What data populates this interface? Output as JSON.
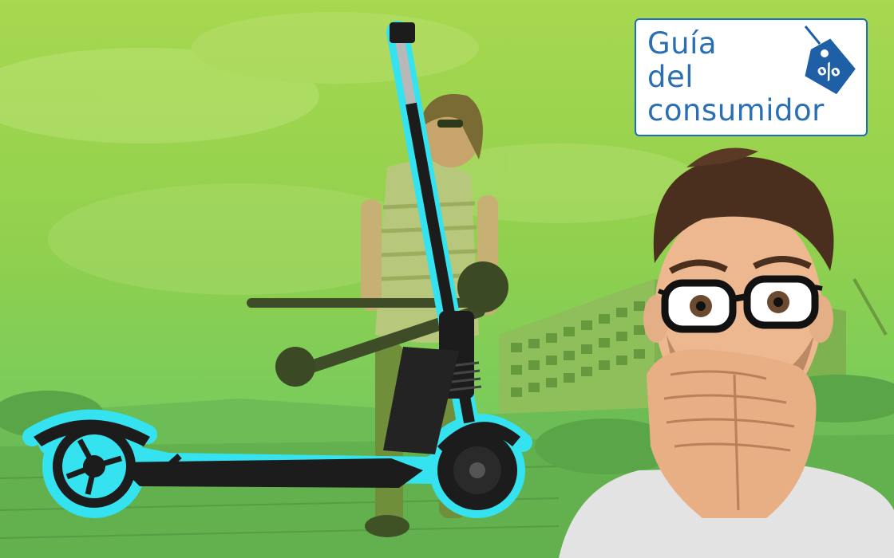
{
  "logo": {
    "line1": "Guía",
    "line2": "del",
    "line3": "consumidor",
    "brand_color": "#2a6fb4",
    "icon": "price-tag-percent-icon"
  },
  "colors": {
    "background_green": "#90d04e",
    "scooter_outline": "#35e2ef",
    "scooter_body": "#1c1c1c"
  }
}
